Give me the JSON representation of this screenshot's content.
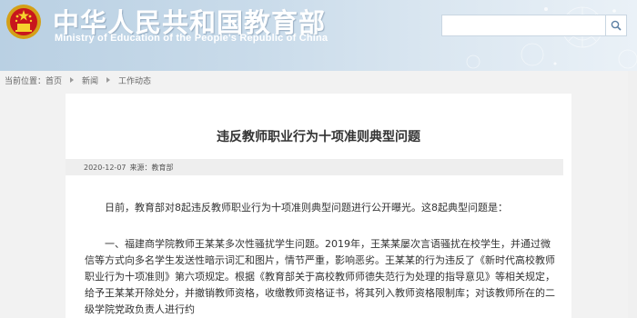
{
  "header": {
    "site_title": "中华人民共和国教育部",
    "site_subtitle": "Ministry of Education of the People's Republic of China",
    "search": {
      "placeholder": "",
      "value": ""
    },
    "emblem_icon": "national-emblem",
    "search_icon": "magnifier-icon",
    "colors": {
      "banner": "#c9dbea",
      "title": "#ffffff"
    }
  },
  "breadcrumb": {
    "label": "当前位置：",
    "items": [
      "首页",
      "新闻",
      "工作动态"
    ]
  },
  "article": {
    "title": "违反教师职业行为十项准则典型问题",
    "date": "2020-12-07",
    "source": "来源：教育部",
    "paragraphs": [
      "日前，教育部对8起违反教师职业行为十项准则典型问题进行公开曝光。这8起典型问题是：",
      "一、福建商学院教师王某某多次性骚扰学生问题。2019年，王某某屡次言语骚扰在校学生，并通过微信等方式向多名学生发送性暗示词汇和图片，情节严重，影响恶劣。王某某的行为违反了《新时代高校教师职业行为十项准则》第六项规定。根据《教育部关于高校教师师德失范行为处理的指导意见》等相关规定，给予王某某开除处分，并撤销教师资格，收缴教师资格证书，将其列入教师资格限制库；对该教师所在的二级学院党政负责人进行约"
    ]
  }
}
